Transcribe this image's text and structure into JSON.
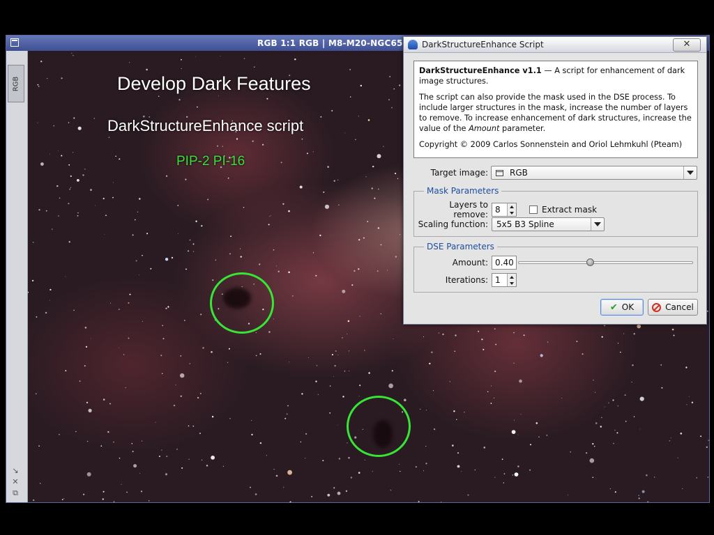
{
  "image_window": {
    "title": "RGB 1:1 RGB | M8-M20-NGC65",
    "side_tab": "RGB",
    "overlay": {
      "title": "Develop Dark Features",
      "subtitle": "DarkStructureEnhance script",
      "code": "PIP-2 PI-16"
    }
  },
  "dialog": {
    "title": "DarkStructureEnhance Script",
    "close_label": "✕",
    "info": {
      "heading": "DarkStructureEnhance v1.1",
      "heading_rest": " — A script for enhancement of dark image structures.",
      "para2_a": "The script can also provide the mask used in the DSE process. To include larger structures in the mask, increase the number of layers to remove. To increase enhancement of dark structures, increase the value of the ",
      "para2_em": "Amount",
      "para2_b": " parameter.",
      "copyright": "Copyright © 2009 Carlos Sonnenstein and Oriol Lehmkuhl (Pteam)"
    },
    "target_image": {
      "label": "Target image:",
      "value": "RGB"
    },
    "mask_parameters": {
      "title": "Mask Parameters",
      "layers_label": "Layers to remove:",
      "layers_value": "8",
      "extract_mask_label": "Extract mask",
      "extract_mask_checked": false,
      "scaling_label": "Scaling function:",
      "scaling_value": "5x5 B3 Spline"
    },
    "dse_parameters": {
      "title": "DSE Parameters",
      "amount_label": "Amount:",
      "amount_value": "0.40",
      "iterations_label": "Iterations:",
      "iterations_value": "1"
    },
    "buttons": {
      "ok": "OK",
      "cancel": "Cancel"
    }
  },
  "colors": {
    "titlebar": "#4a5ba0",
    "group_title": "#1c4fa0",
    "highlight_circle": "#37e635"
  }
}
